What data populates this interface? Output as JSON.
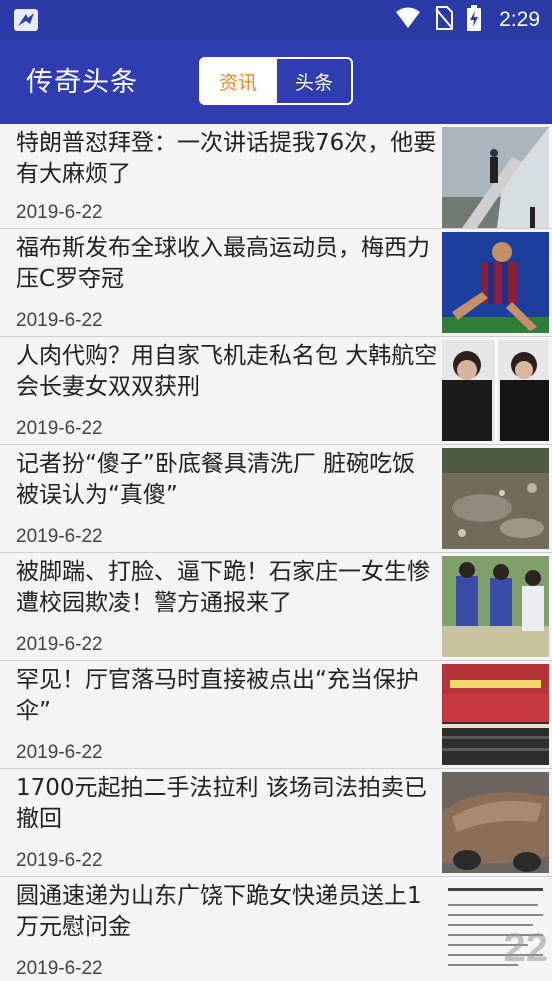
{
  "status_bar": {
    "time": "2:29",
    "icons": [
      "app-notification-icon",
      "wifi-icon",
      "no-sim-icon",
      "battery-charging-icon"
    ]
  },
  "app_bar": {
    "title": "传奇头条",
    "tabs": [
      {
        "label": "资讯",
        "active": true
      },
      {
        "label": "头条",
        "active": false
      }
    ]
  },
  "news": [
    {
      "title": "特朗普怼拜登：一次讲话提我76次，他要有大麻烦了",
      "date": "2019-6-22",
      "thumb": "airplane-stairs"
    },
    {
      "title": "福布斯发布全球收入最高运动员，梅西力压C罗夺冠",
      "date": "2019-6-22",
      "thumb": "football-player"
    },
    {
      "title": "人肉代购？用自家飞机走私名包 大韩航空会长妻女双双获刑",
      "date": "2019-6-22",
      "thumb": "court-people"
    },
    {
      "title": "记者扮“傻子”卧底餐具清洗厂 脏碗吃饭被误认为“真傻”",
      "date": "2019-6-22",
      "thumb": "dirty-ground"
    },
    {
      "title": "被脚踹、打脸、逼下跪！石家庄一女生惨遭校园欺凌！警方通报来了",
      "date": "2019-6-22",
      "thumb": "students"
    },
    {
      "title": "罕见！厅官落马时直接被点出“充当保护伞”",
      "date": "2019-6-22",
      "thumb": "meeting-hall"
    },
    {
      "title": "1700元起拍二手法拉利 该场司法拍卖已撤回",
      "date": "2019-6-22",
      "thumb": "dusty-car"
    },
    {
      "title": "圆通速递为山东广饶下跪女快递员送上1万元慰问金",
      "date": "2019-6-22",
      "thumb": "text-document"
    }
  ],
  "watermark": "22"
}
